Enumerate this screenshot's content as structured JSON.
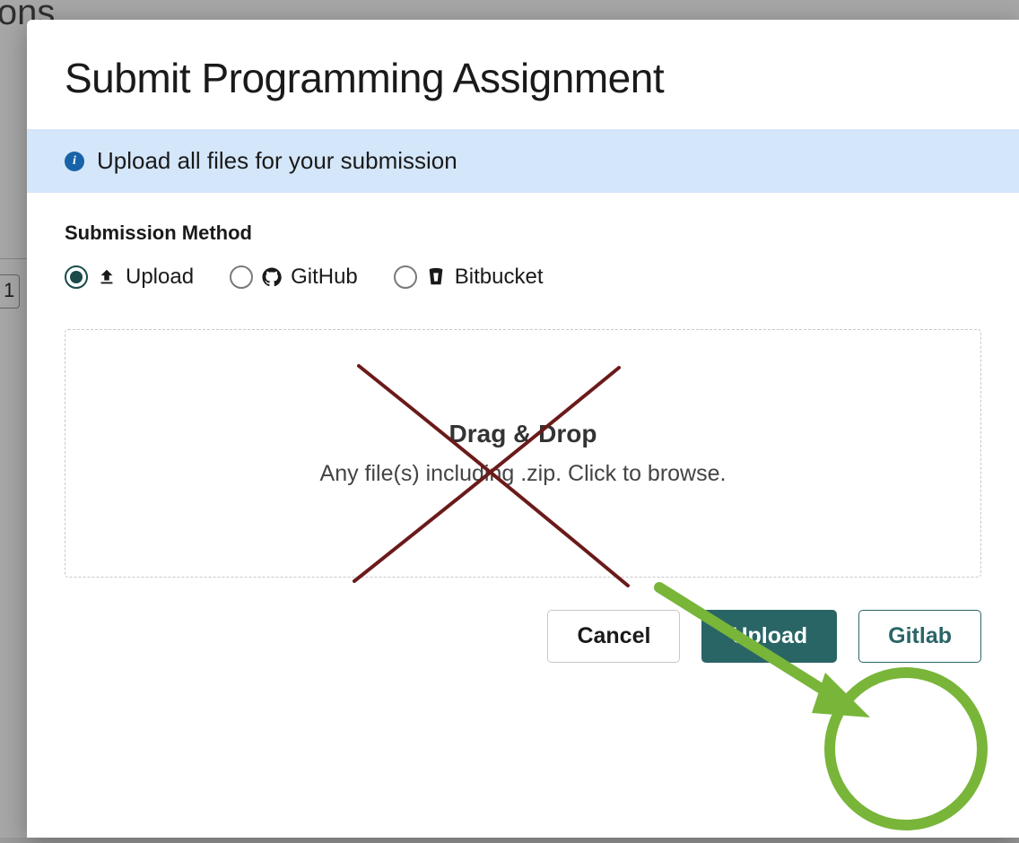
{
  "background": {
    "heading_fragment": "ions",
    "input_value": "1"
  },
  "modal": {
    "title": "Submit Programming Assignment",
    "info_text": "Upload all files for your submission",
    "section_label": "Submission Method",
    "methods": [
      {
        "label": "Upload",
        "icon": "upload-icon",
        "selected": true
      },
      {
        "label": "GitHub",
        "icon": "github-icon",
        "selected": false
      },
      {
        "label": "Bitbucket",
        "icon": "bitbucket-icon",
        "selected": false
      }
    ],
    "dropzone": {
      "title": "Drag & Drop",
      "subtitle": "Any file(s) including .zip. Click to browse."
    },
    "buttons": {
      "cancel": "Cancel",
      "upload": "Upload",
      "gitlab": "Gitlab"
    }
  },
  "annotations": {
    "x_color": "#6b1a1a",
    "arrow_color": "#78b539",
    "circle_color": "#78b539"
  }
}
